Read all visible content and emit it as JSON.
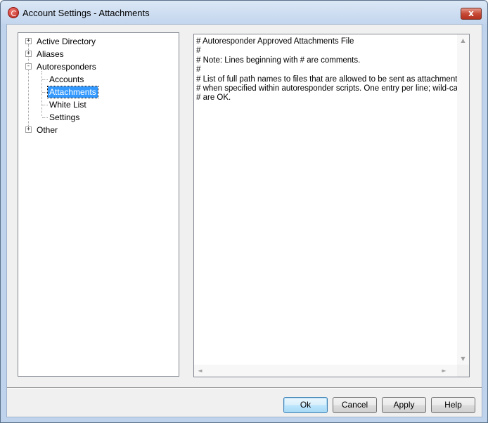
{
  "window": {
    "title": "Account Settings - Attachments",
    "close_label": "x"
  },
  "tree": {
    "items": [
      {
        "label": "Active Directory",
        "expander": "+",
        "level": 0
      },
      {
        "label": "Aliases",
        "expander": "+",
        "level": 0
      },
      {
        "label": "Autoresponders",
        "expander": "-",
        "level": 0
      },
      {
        "label": "Accounts",
        "level": 1
      },
      {
        "label": "Attachments",
        "level": 1,
        "selected": true
      },
      {
        "label": "White List",
        "level": 1
      },
      {
        "label": "Settings",
        "level": 1
      },
      {
        "label": "Other",
        "expander": "+",
        "level": 0
      }
    ]
  },
  "editor": {
    "text": "# Autoresponder Approved Attachments File\n#\n# Note: Lines beginning with # are comments.\n#\n# List of full path names to files that are allowed to be sent as attachments\n# when specified within autoresponder scripts. One entry per line; wild-cards\n# are OK."
  },
  "buttons": {
    "ok": "Ok",
    "cancel": "Cancel",
    "apply": "Apply",
    "help": "Help"
  },
  "icons": {
    "up": "▲",
    "down": "▼",
    "left": "◄",
    "right": "►"
  }
}
